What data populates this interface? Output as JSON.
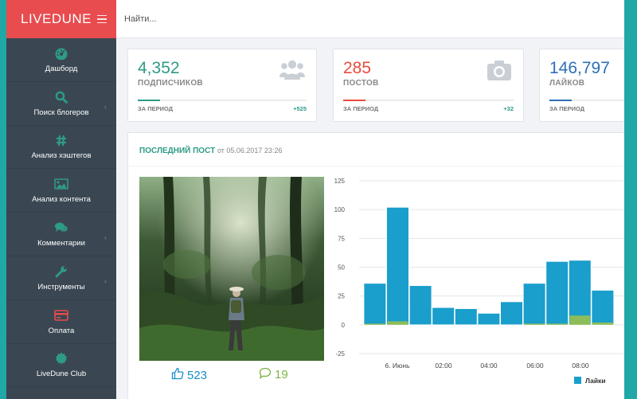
{
  "brand": {
    "name": "LIVEDUNE"
  },
  "search": {
    "placeholder": "Найти..."
  },
  "sidebar": {
    "items": [
      {
        "label": "Дашборд",
        "icon": "dashboard-icon",
        "has_submenu": false
      },
      {
        "label": "Поиск блогеров",
        "icon": "search-icon",
        "has_submenu": true
      },
      {
        "label": "Анализ хэштегов",
        "icon": "hashtag-icon",
        "has_submenu": false
      },
      {
        "label": "Анализ контента",
        "icon": "image-icon",
        "has_submenu": false
      },
      {
        "label": "Комментарии",
        "icon": "comments-icon",
        "has_submenu": true
      },
      {
        "label": "Инструменты",
        "icon": "wrench-icon",
        "has_submenu": true
      },
      {
        "label": "Оплата",
        "icon": "credit-card-icon",
        "has_submenu": false
      },
      {
        "label": "LiveDune Club",
        "icon": "club-badge-icon",
        "has_submenu": false
      }
    ]
  },
  "cards": [
    {
      "value": "4,352",
      "label": "ПОДПИСЧИКОВ",
      "period": "ЗА ПЕРИОД",
      "change": "+525",
      "color": "#2e9b86",
      "icon": "users-icon"
    },
    {
      "value": "285",
      "label": "ПОСТОВ",
      "period": "ЗА ПЕРИОД",
      "change": "+32",
      "color": "#e84c3d",
      "icon": "camera-icon"
    },
    {
      "value": "146,797",
      "label": "ЛАЙКОВ",
      "period": "ЗА ПЕРИОД",
      "change": "",
      "color": "#2d6fb7",
      "icon": "heart-icon"
    }
  ],
  "post": {
    "title": "ПОСЛЕДНИЙ ПОСТ",
    "date": "от 05.06.2017 23:26",
    "likes": "523",
    "comments": "19"
  },
  "chart_data": {
    "type": "bar",
    "y_ticks": [
      125,
      100,
      75,
      50,
      25,
      0,
      -25
    ],
    "ylim": [
      -25,
      125
    ],
    "x_tick_labels": [
      "6. Июнь",
      "02:00",
      "04:00",
      "06:00",
      "08:00"
    ],
    "series": [
      {
        "name": "Лайки",
        "color": "#1a9ecc",
        "values": [
          36,
          102,
          34,
          15,
          14,
          10,
          20,
          36,
          55,
          56,
          30
        ]
      },
      {
        "name": "",
        "color": "#8dbd5a",
        "values": [
          1,
          3,
          0,
          0,
          0,
          0,
          0,
          1,
          1,
          8,
          2
        ]
      }
    ],
    "legend": {
      "position": "bottom-right",
      "label": "Лайки"
    },
    "grid": true
  }
}
